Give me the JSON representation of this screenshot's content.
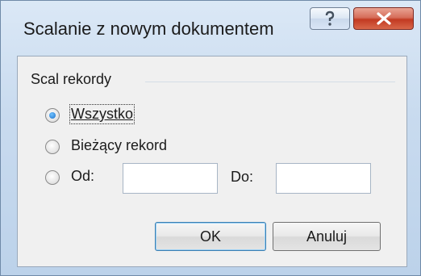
{
  "window": {
    "title": "Scalanie z nowym dokumentem",
    "help_glyph": "?",
    "close_glyph": "X"
  },
  "group": {
    "label": "Scal rekordy",
    "options": [
      {
        "label": "Wszystko",
        "selected": true
      },
      {
        "label": "Bieżący rekord",
        "selected": false
      },
      {
        "label": "Od:",
        "selected": false
      }
    ],
    "to_label": "Do:",
    "from_value": "",
    "to_value": ""
  },
  "buttons": {
    "ok": "OK",
    "cancel": "Anuluj"
  }
}
